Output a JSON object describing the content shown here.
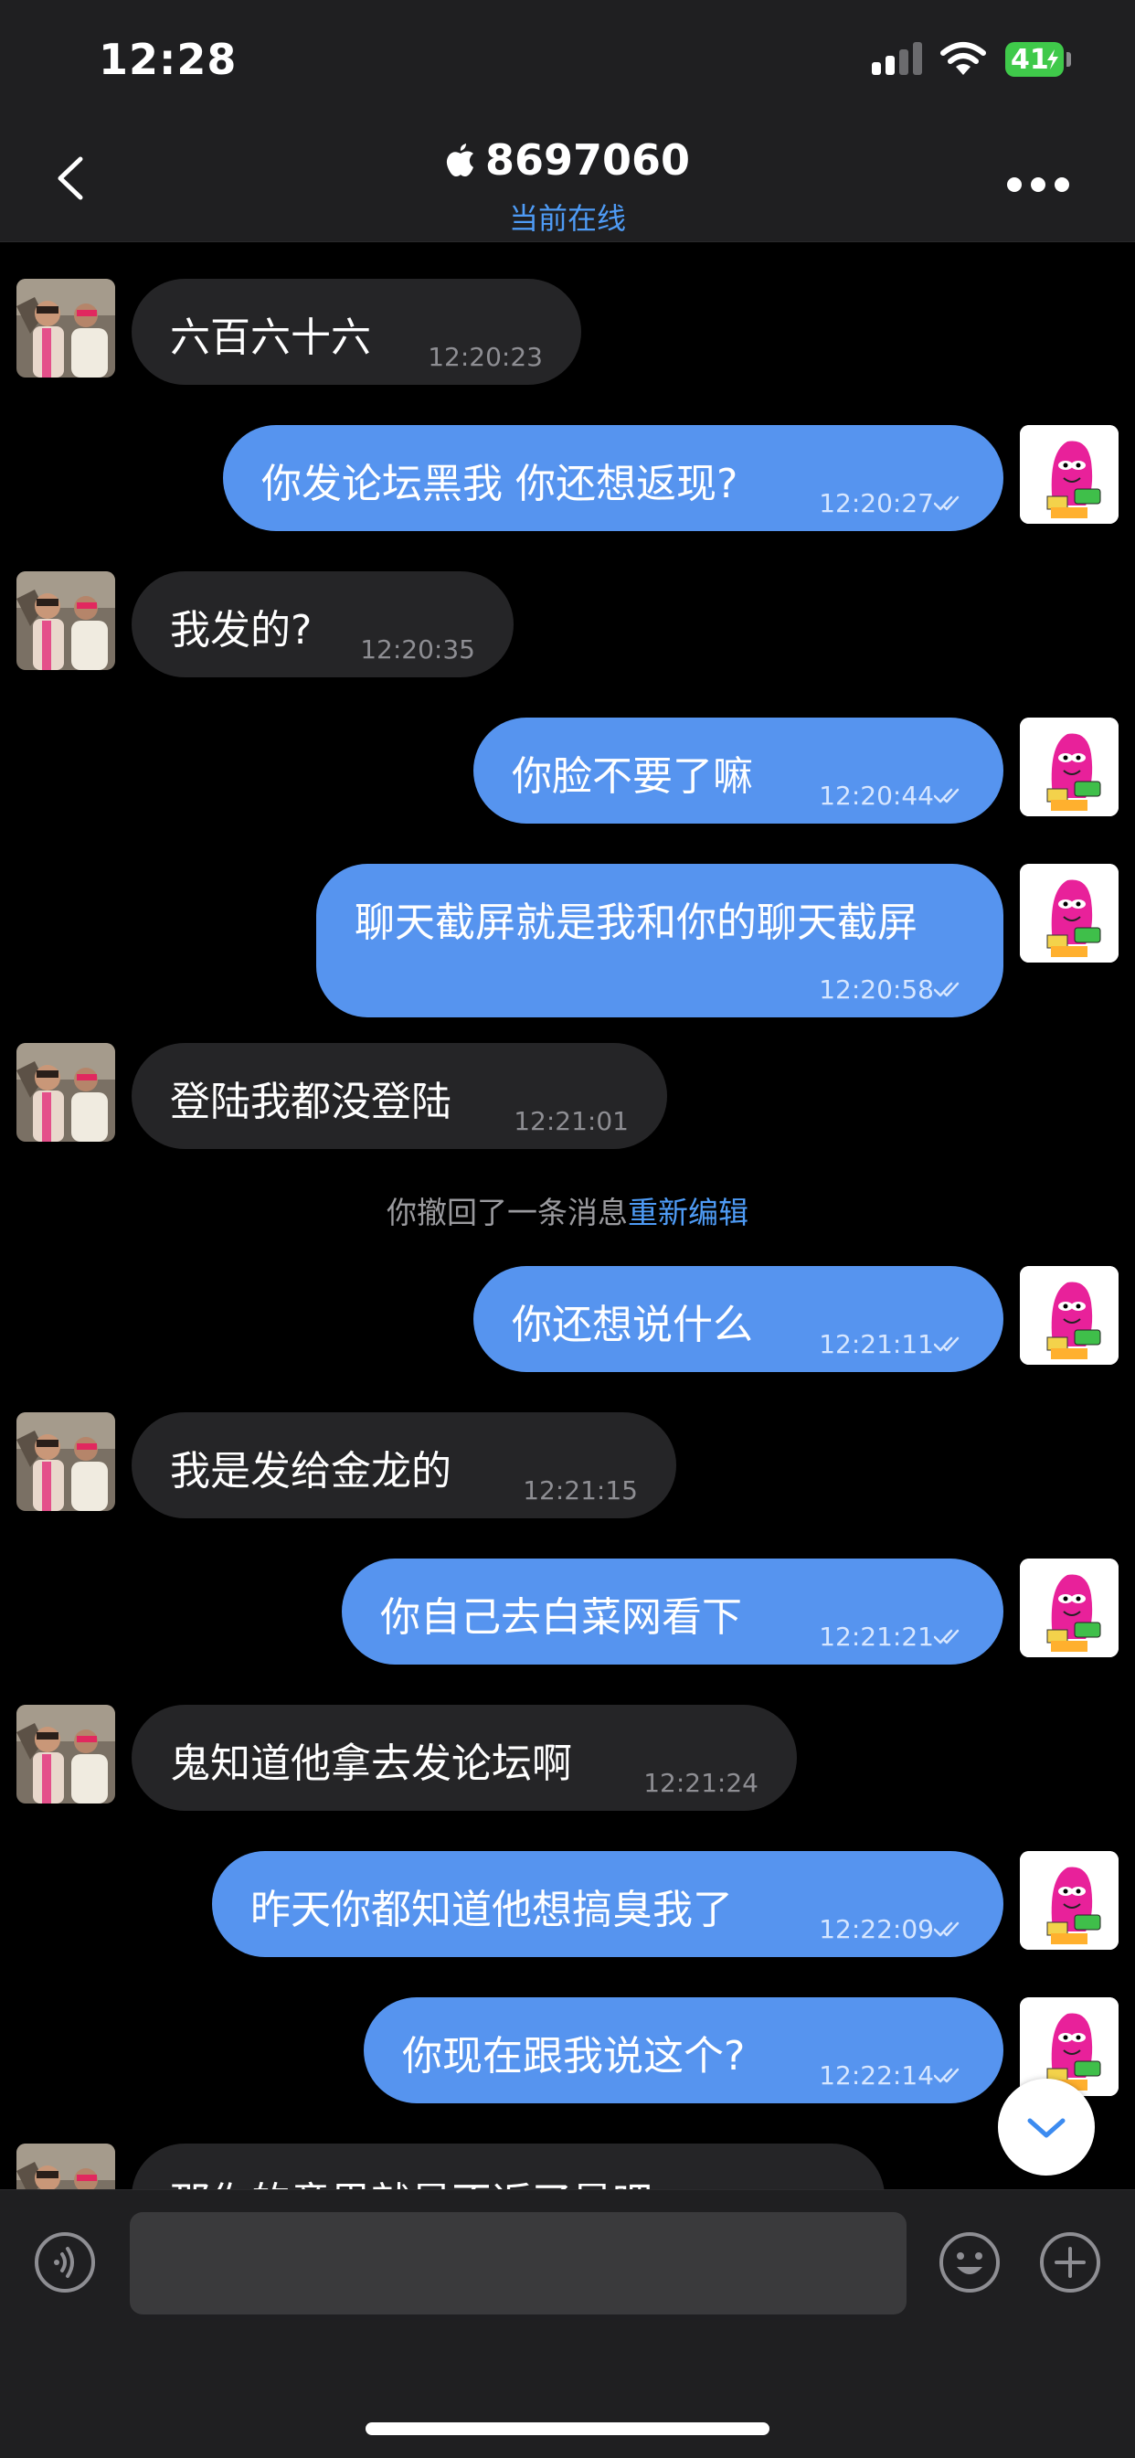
{
  "status_bar": {
    "time": "12:28",
    "battery": "41"
  },
  "header": {
    "title": "8697060",
    "subtitle": "当前在线"
  },
  "messages": [
    {
      "dir": "in",
      "text": "六百六十六",
      "time": "12:20:23"
    },
    {
      "dir": "out",
      "text": "你发论坛黑我 你还想返现?",
      "time": "12:20:27"
    },
    {
      "dir": "in",
      "text": "我发的?",
      "time": "12:20:35"
    },
    {
      "dir": "out",
      "text": "你脸不要了嘛",
      "time": "12:20:44"
    },
    {
      "dir": "out",
      "text": "聊天截屏就是我和你的聊天截屏",
      "time": "12:20:58"
    },
    {
      "dir": "in",
      "text": "登陆我都没登陆",
      "time": "12:21:01"
    },
    {
      "dir": "out",
      "text": "你还想说什么",
      "time": "12:21:11"
    },
    {
      "dir": "in",
      "text": "我是发给金龙的",
      "time": "12:21:15"
    },
    {
      "dir": "out",
      "text": "你自己去白菜网看下",
      "time": "12:21:21"
    },
    {
      "dir": "in",
      "text": "鬼知道他拿去发论坛啊",
      "time": "12:21:24"
    },
    {
      "dir": "out",
      "text": "昨天你都知道他想搞臭我了",
      "time": "12:22:09"
    },
    {
      "dir": "out",
      "text": "你现在跟我说这个?",
      "time": "12:22:14"
    },
    {
      "dir": "in",
      "text": "那你的意思就是不返了是吧",
      "time": ""
    }
  ],
  "system_message": {
    "text": "你撤回了一条消息",
    "action": "重新编辑"
  },
  "avatar_label": "土豆",
  "colors": {
    "accent": "#4e9bf5",
    "outgoing_bubble": "#5694ef",
    "incoming_bubble": "#252527",
    "background": "#000000"
  },
  "icons": [
    "back-icon",
    "apple-icon",
    "more-icon",
    "read-ticks-icon",
    "scroll-down-icon",
    "voice-icon",
    "emoji-icon",
    "plus-icon"
  ]
}
